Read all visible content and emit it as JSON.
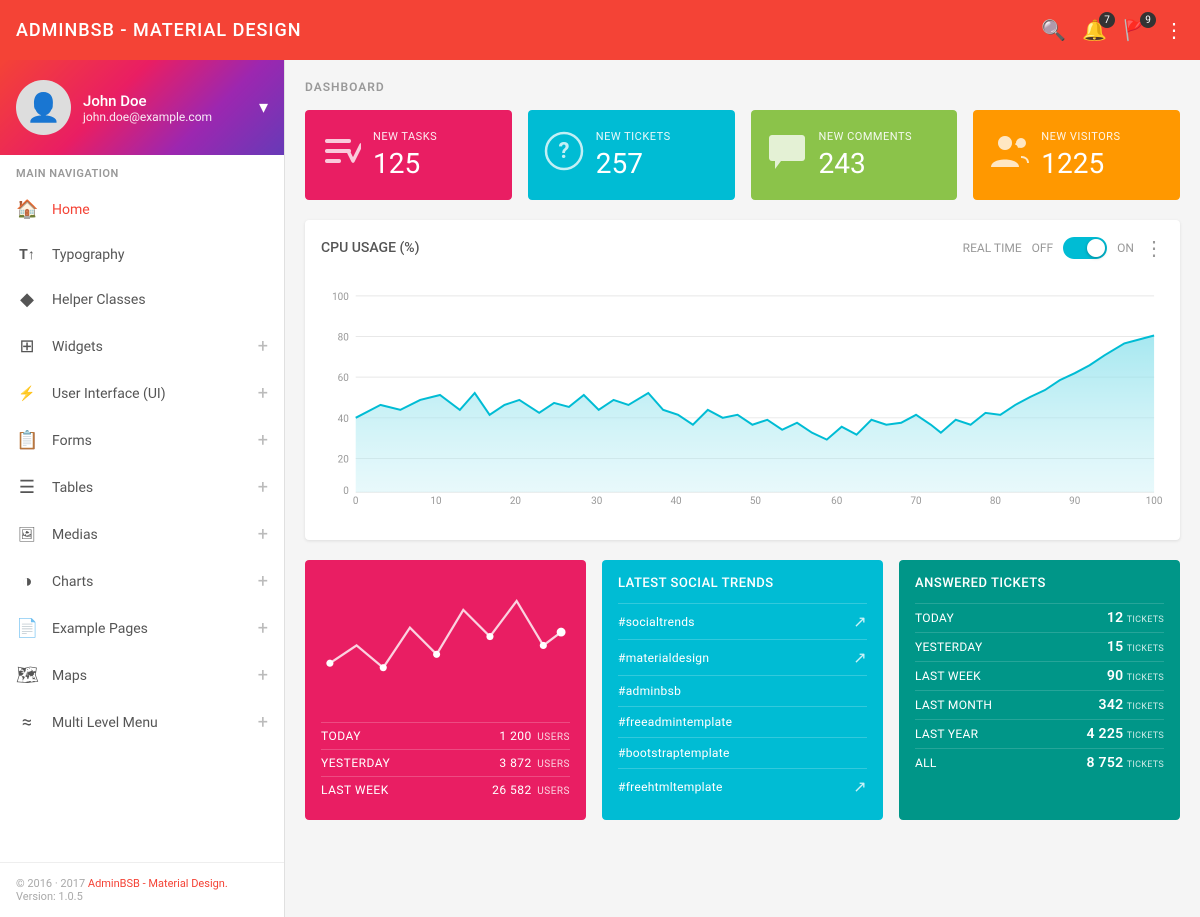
{
  "app": {
    "title": "ADMINBSB - MATERIAL DESIGN",
    "version": "Version: 1.0.5",
    "copyright": "© 2016 · 2017 AdminBSB - Material Design.",
    "badge_notifications": "7",
    "badge_messages": "9"
  },
  "sidebar": {
    "profile": {
      "name": "John Doe",
      "email": "john.doe@example.com"
    },
    "nav_label": "MAIN NAVIGATION",
    "items": [
      {
        "id": "home",
        "label": "Home",
        "icon": "🏠",
        "active": true,
        "has_plus": false
      },
      {
        "id": "typography",
        "label": "Typography",
        "icon": "T↑",
        "active": false,
        "has_plus": false
      },
      {
        "id": "helper-classes",
        "label": "Helper Classes",
        "icon": "◆",
        "active": false,
        "has_plus": false
      },
      {
        "id": "widgets",
        "label": "Widgets",
        "icon": "⊞",
        "active": false,
        "has_plus": true
      },
      {
        "id": "user-interface",
        "label": "User Interface (UI)",
        "icon": "⚡",
        "active": false,
        "has_plus": true
      },
      {
        "id": "forms",
        "label": "Forms",
        "icon": "📋",
        "active": false,
        "has_plus": true
      },
      {
        "id": "tables",
        "label": "Tables",
        "icon": "☰",
        "active": false,
        "has_plus": true
      },
      {
        "id": "medias",
        "label": "Medias",
        "icon": "🖼",
        "active": false,
        "has_plus": true
      },
      {
        "id": "charts",
        "label": "Charts",
        "icon": "◑",
        "active": false,
        "has_plus": true
      },
      {
        "id": "example-pages",
        "label": "Example Pages",
        "icon": "📄",
        "active": false,
        "has_plus": true
      },
      {
        "id": "maps",
        "label": "Maps",
        "icon": "🗺",
        "active": false,
        "has_plus": true
      },
      {
        "id": "multi-level",
        "label": "Multi Level Menu",
        "icon": "≈",
        "active": false,
        "has_plus": true
      }
    ]
  },
  "dashboard": {
    "page_title": "DASHBOARD",
    "stat_cards": [
      {
        "id": "tasks",
        "label": "NEW TASKS",
        "value": "125",
        "color": "stat-pink",
        "icon": "✔"
      },
      {
        "id": "tickets",
        "label": "NEW TICKETS",
        "value": "257",
        "color": "stat-teal",
        "icon": "?"
      },
      {
        "id": "comments",
        "label": "NEW COMMENTS",
        "value": "243",
        "color": "stat-green",
        "icon": "💬"
      },
      {
        "id": "visitors",
        "label": "NEW VISITORS",
        "value": "1225",
        "color": "stat-orange",
        "icon": "👤+"
      }
    ],
    "cpu_chart": {
      "title": "CPU USAGE (%)",
      "real_time_label": "REAL TIME",
      "off_label": "OFF",
      "on_label": "ON",
      "y_labels": [
        "100",
        "80",
        "60",
        "40",
        "20",
        "0"
      ],
      "x_labels": [
        "0",
        "10",
        "20",
        "30",
        "40",
        "50",
        "60",
        "70",
        "80",
        "90",
        "100"
      ]
    },
    "pink_card": {
      "stats": [
        {
          "label": "TODAY",
          "value": "1 200",
          "unit": "USERS"
        },
        {
          "label": "YESTERDAY",
          "value": "3 872",
          "unit": "USERS"
        },
        {
          "label": "LAST WEEK",
          "value": "26 582",
          "unit": "USERS"
        }
      ]
    },
    "social_trends": {
      "title": "LATEST SOCIAL TRENDS",
      "items": [
        {
          "tag": "#socialtrends",
          "has_arrow": true
        },
        {
          "tag": "#materialdesign",
          "has_arrow": true
        },
        {
          "tag": "#adminbsb",
          "has_arrow": false
        },
        {
          "tag": "#freeadmintemplate",
          "has_arrow": false
        },
        {
          "tag": "#bootstraptemplate",
          "has_arrow": false
        },
        {
          "tag": "#freehtmltemplate",
          "has_arrow": true
        }
      ]
    },
    "answered_tickets": {
      "title": "ANSWERED TICKETS",
      "items": [
        {
          "label": "TODAY",
          "value": "12",
          "unit": "TICKETS"
        },
        {
          "label": "YESTERDAY",
          "value": "15",
          "unit": "TICKETS"
        },
        {
          "label": "LAST WEEK",
          "value": "90",
          "unit": "TICKETS"
        },
        {
          "label": "LAST MONTH",
          "value": "342",
          "unit": "TICKETS"
        },
        {
          "label": "LAST YEAR",
          "value": "4 225",
          "unit": "TICKETS"
        },
        {
          "label": "ALL",
          "value": "8 752",
          "unit": "TICKETS"
        }
      ]
    }
  }
}
